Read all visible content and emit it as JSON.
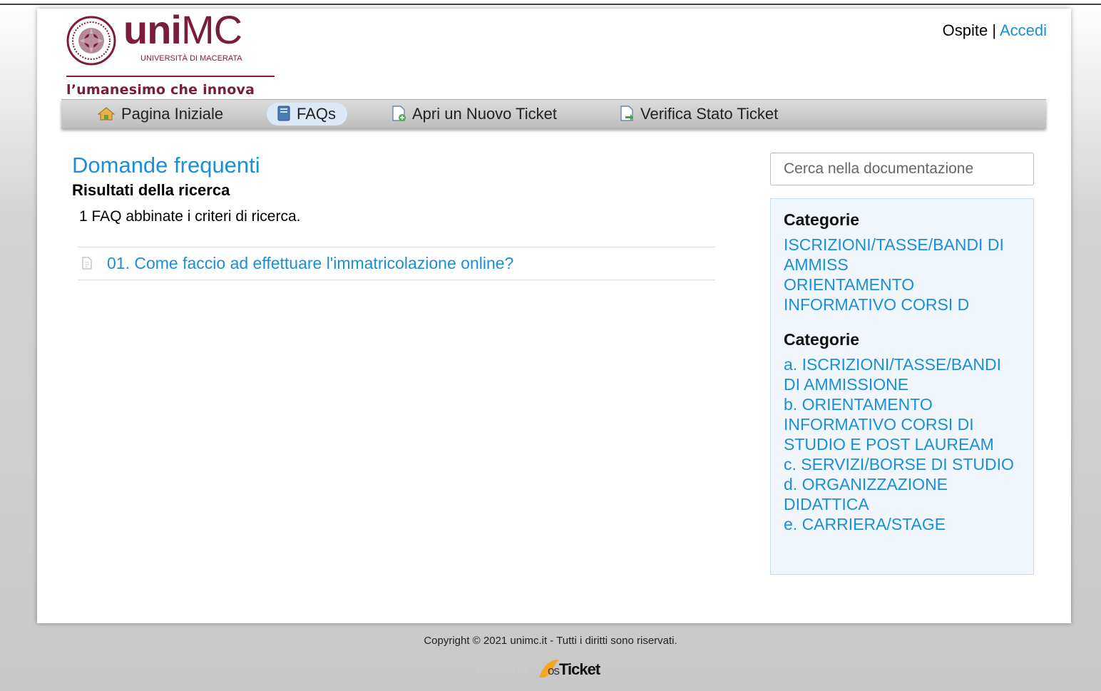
{
  "header": {
    "logo_word_bold": "uni",
    "logo_word_rest": "MC",
    "logo_sub": "UNIVERSITÀ DI MACERATA",
    "tagline": "l’umanesimo che innova",
    "user_label": "Ospite",
    "user_sep": " | ",
    "login_link": "Accedi"
  },
  "nav": {
    "items": [
      {
        "label": "Pagina Iniziale",
        "icon": "home-icon"
      },
      {
        "label": "FAQs",
        "icon": "book-icon",
        "active": true
      },
      {
        "label": "Apri un Nuovo Ticket",
        "icon": "new-ticket-icon"
      },
      {
        "label": "Verifica Stato Ticket",
        "icon": "ticket-status-icon"
      }
    ]
  },
  "main": {
    "title": "Domande frequenti",
    "subtitle": "Risultati della ricerca",
    "result_count": "1 FAQ abbinate i criteri di ricerca.",
    "faqs": [
      {
        "label": "01. Come faccio ad effettuare l'immatricolazione online?",
        "icon": "document-icon"
      }
    ]
  },
  "sidebar": {
    "search_placeholder": "Cerca nella documentazione",
    "featured_heading": "Categorie",
    "featured": [
      "ISCRIZIONI/TASSE/BANDI DI AMMISS",
      "ORIENTAMENTO INFORMATIVO CORSI D"
    ],
    "categories_heading": "Categorie",
    "categories": [
      "a. ISCRIZIONI/TASSE/BANDI DI AMMISSIONE",
      "b. ORIENTAMENTO INFORMATIVO CORSI DI STUDIO E POST LAUREAM",
      "c. SERVIZI/BORSE DI STUDIO",
      "d. ORGANIZZAZIONE DIDATTICA",
      "e. CARRIERA/STAGE"
    ]
  },
  "footer": {
    "copyright": "Copyright © 2021 unimc.it - Tutti i diritti sono riservati.",
    "powered_by": "powered by",
    "brand_os": "os",
    "brand_ticket": "Ticket"
  },
  "colors": {
    "link": "#1a8fd8",
    "brand": "#7a1d3a",
    "sidebar_bg": "#f0f6fc"
  }
}
